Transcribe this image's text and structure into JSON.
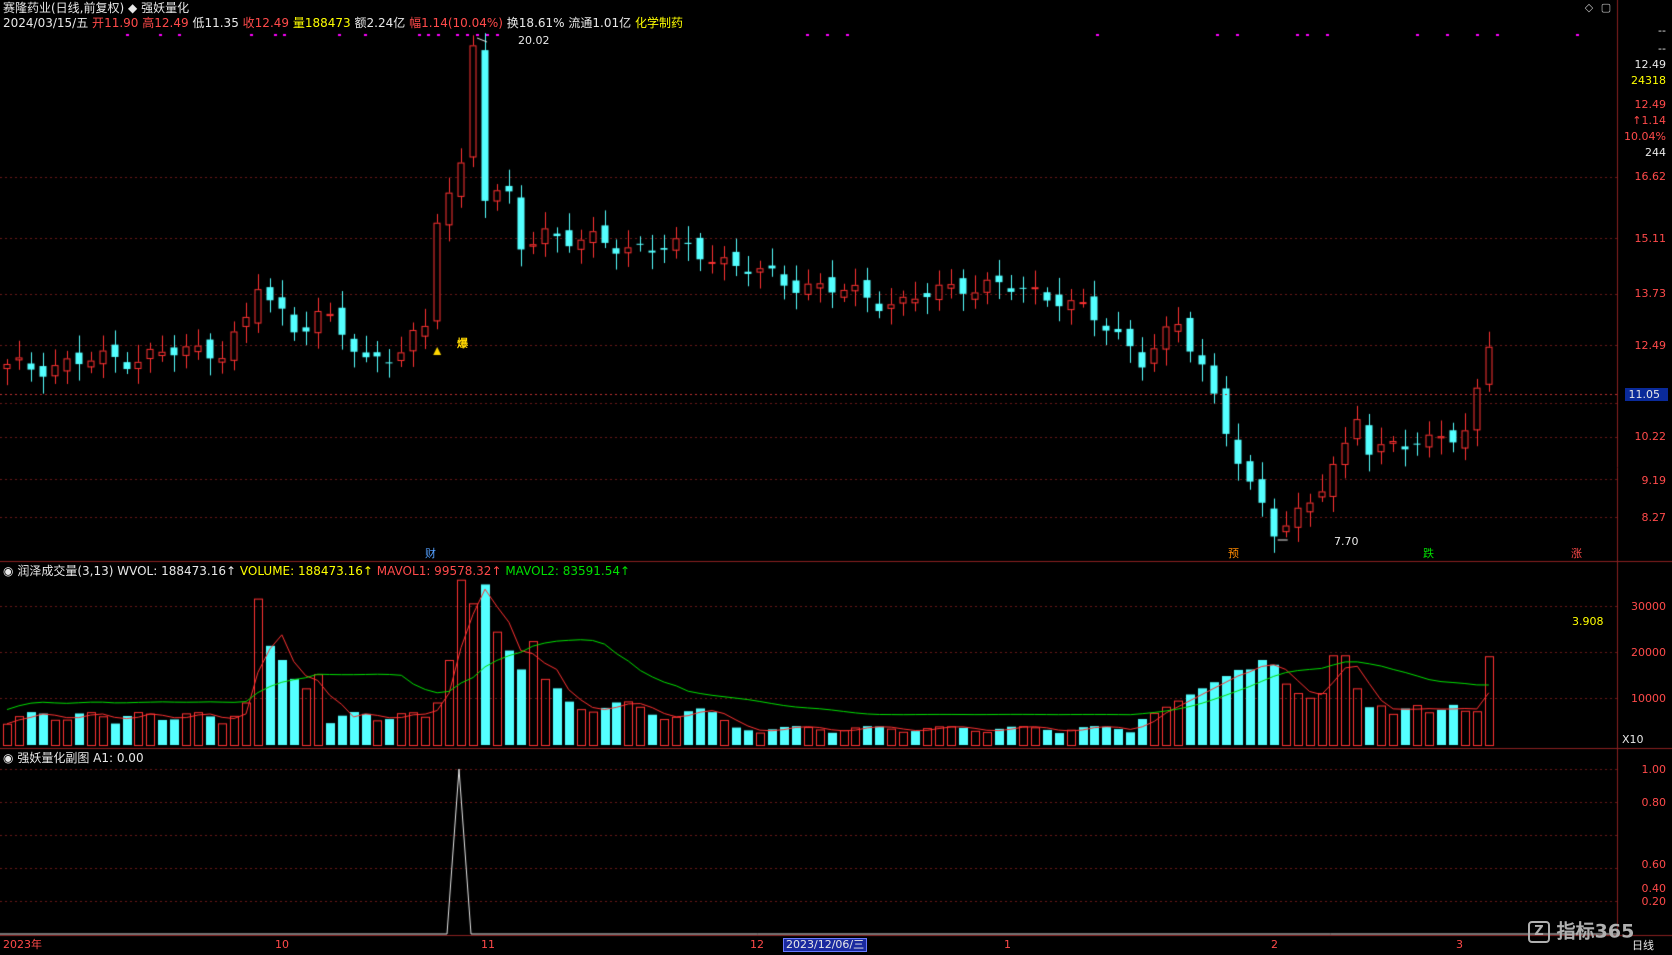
{
  "header": {
    "stock_name": "赛隆药业(日线,前复权)",
    "indicator_name": "强妖量化",
    "date": "2024/03/15/五",
    "open_label": "开",
    "open": "11.90",
    "high_label": "高",
    "high": "12.49",
    "low_label": "低",
    "low": "11.35",
    "close_label": "收",
    "close": "12.49",
    "volume_label": "量",
    "volume": "188473",
    "amount_label": "额",
    "amount": "2.24亿",
    "change_label": "幅",
    "change": "1.14(10.04%)",
    "turnover_label": "换",
    "turnover": "18.61%",
    "float_label": "流通",
    "float": "1.01亿",
    "sector": "化学制药"
  },
  "right_panel": {
    "v1": "--",
    "v2": "--",
    "price": "12.49",
    "vol": "24318",
    "price2": "12.49",
    "chg": "↑1.14",
    "pct": "10.04%",
    "num": "244"
  },
  "price_axis": [
    "16.62",
    "15.11",
    "13.73",
    "12.49",
    "11.05",
    "10.22",
    "9.19",
    "8.27"
  ],
  "price_markers": {
    "high": "20.02",
    "low": "7.70",
    "current": "11.05"
  },
  "event_markers": [
    "财",
    "预",
    "跌",
    "涨",
    "爆"
  ],
  "volume_panel": {
    "title": "润泽成交量(3,13)",
    "wvol": "WVOL: 188473.16↑",
    "volume": "VOLUME: 188473.16↑",
    "mavol1": "MAVOL1: 99578.32↑",
    "mavol2": "MAVOL2: 83591.54↑",
    "axis": [
      "30000",
      "20000",
      "10000"
    ],
    "ratio": "3.908",
    "unit": "X10"
  },
  "sub_panel": {
    "title": "强妖量化副图",
    "a1": "A1: 0.00",
    "axis": [
      "1.00",
      "0.80",
      "0.60",
      "0.40",
      "0.20"
    ]
  },
  "time_axis": {
    "labels": [
      "2023年",
      "10",
      "11",
      "12",
      "1",
      "2",
      "3"
    ],
    "cursor_date": "2023/12/06/三"
  },
  "footer": {
    "logo": "指标365",
    "period": "日线"
  },
  "colors": {
    "up": "#ff3232",
    "down": "#54ffff",
    "bg": "#000000",
    "grid": "#8a2020"
  },
  "chart_data": {
    "type": "candlestick",
    "price_high": 20.02,
    "price_low": 7.7
  }
}
